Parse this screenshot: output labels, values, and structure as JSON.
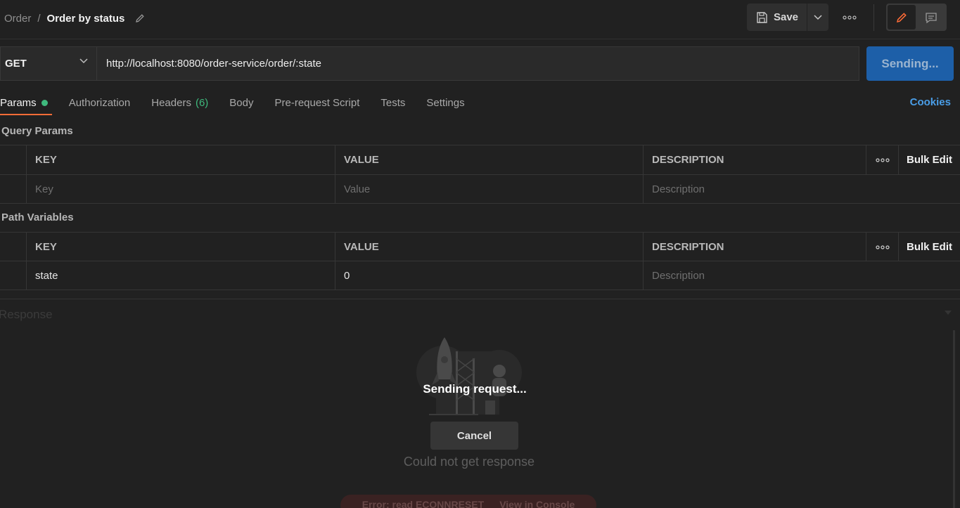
{
  "breadcrumb": {
    "parent": "Order",
    "separator": "/",
    "current": "Order by status"
  },
  "toolbar": {
    "save_label": "Save"
  },
  "request": {
    "method": "GET",
    "url": "http://localhost:8080/order-service/order/:state",
    "send_label": "Sending..."
  },
  "tabs": [
    {
      "label": "Params",
      "active": true,
      "indicator": "green-dot"
    },
    {
      "label": "Authorization"
    },
    {
      "label": "Headers",
      "count": "(6)"
    },
    {
      "label": "Body"
    },
    {
      "label": "Pre-request Script"
    },
    {
      "label": "Tests"
    },
    {
      "label": "Settings"
    }
  ],
  "cookies_label": "Cookies",
  "query_params": {
    "title": "Query Params",
    "headers": {
      "key": "KEY",
      "value": "VALUE",
      "description": "DESCRIPTION",
      "bulk_edit": "Bulk Edit"
    },
    "placeholder_row": {
      "key": "Key",
      "value": "Value",
      "description": "Description"
    }
  },
  "path_variables": {
    "title": "Path Variables",
    "headers": {
      "key": "KEY",
      "value": "VALUE",
      "description": "DESCRIPTION",
      "bulk_edit": "Bulk Edit"
    },
    "rows": [
      {
        "key": "state",
        "value": "0",
        "description_placeholder": "Description"
      }
    ]
  },
  "response": {
    "title": "Response",
    "sending_text": "Sending request...",
    "cancel_label": "Cancel",
    "no_response_text": "Could not get response",
    "error_text": "Error: read ECONNRESET",
    "console_link": "View in Console"
  },
  "colors": {
    "accent": "#ff6c37",
    "send": "#1d5fa8",
    "link": "#4a9ee8",
    "success": "#3fb97d"
  }
}
